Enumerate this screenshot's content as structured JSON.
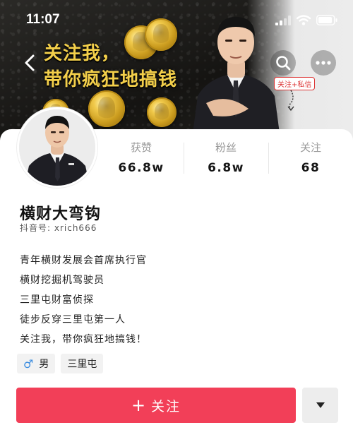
{
  "status_bar": {
    "time": "11:07"
  },
  "banner": {
    "headline_line1": "关注我，",
    "headline_line2": "带你疯狂地搞钱",
    "follow_hint": "关注+私信"
  },
  "profile": {
    "name": "横财大弯钩",
    "handle": "抖音号: xrich666",
    "stats": [
      {
        "label": "获赞",
        "value": "66.8w"
      },
      {
        "label": "粉丝",
        "value": "6.8w"
      },
      {
        "label": "关注",
        "value": "68"
      }
    ],
    "bio": [
      "青年横财发展会首席执行官",
      "横财挖掘机驾驶员",
      "三里屯财富侦探",
      "徒步反穿三里屯第一人",
      "关注我，带你疯狂地搞钱！"
    ],
    "tags": {
      "gender_symbol": "♂",
      "gender": "男",
      "location": "三里屯"
    }
  },
  "actions": {
    "follow_label": "关注",
    "follow_plus": "+"
  },
  "icons": [
    "back-icon",
    "search-icon",
    "more-icon",
    "signal-icon",
    "wifi-icon",
    "battery-icon",
    "dropdown-triangle-icon",
    "male-icon"
  ],
  "colors": {
    "accent": "#f23f58",
    "headline": "#f3cf4a",
    "male": "#3b8de0"
  }
}
